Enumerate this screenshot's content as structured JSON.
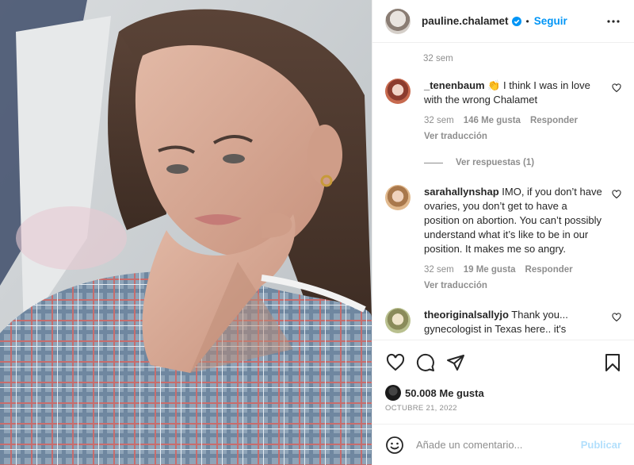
{
  "header": {
    "username": "pauline.chalamet",
    "separator": "•",
    "follow_label": "Seguir",
    "more_icon": "more-horizontal-icon"
  },
  "post": {
    "caption_time": "32 sem"
  },
  "comments": [
    {
      "user": "_tenenbaum",
      "emoji": "👏",
      "text": " I think I was in love with the wrong Chalamet",
      "time": "32 sem",
      "likes": "146 Me gusta",
      "reply": "Responder",
      "translate": "Ver traducción",
      "view_replies": "Ver respuestas (1)"
    },
    {
      "user": "sarahallynshap",
      "text": " IMO, if you don’t have ovaries, you don’t get to have a position on abortion. You can’t possibly understand what it’s like to be in our position. It makes me so angry.",
      "time": "32 sem",
      "likes": "19 Me gusta",
      "reply": "Responder",
      "translate": "Ver traducción"
    },
    {
      "user": "theoriginalsallyjo",
      "text": " Thank you... gynecologist in Texas here.. it's"
    }
  ],
  "actions": {
    "like_icon": "heart-icon",
    "comment_icon": "comment-icon",
    "share_icon": "share-icon",
    "save_icon": "bookmark-icon"
  },
  "likes": "50.008 Me gusta",
  "date": "OCTUBRE 21, 2022",
  "add_comment": {
    "placeholder": "Añade un comentario...",
    "post_label": "Publicar"
  },
  "colors": {
    "link": "#0095f6",
    "muted": "#8e8e8e",
    "post_disabled": "#b2dffc"
  }
}
